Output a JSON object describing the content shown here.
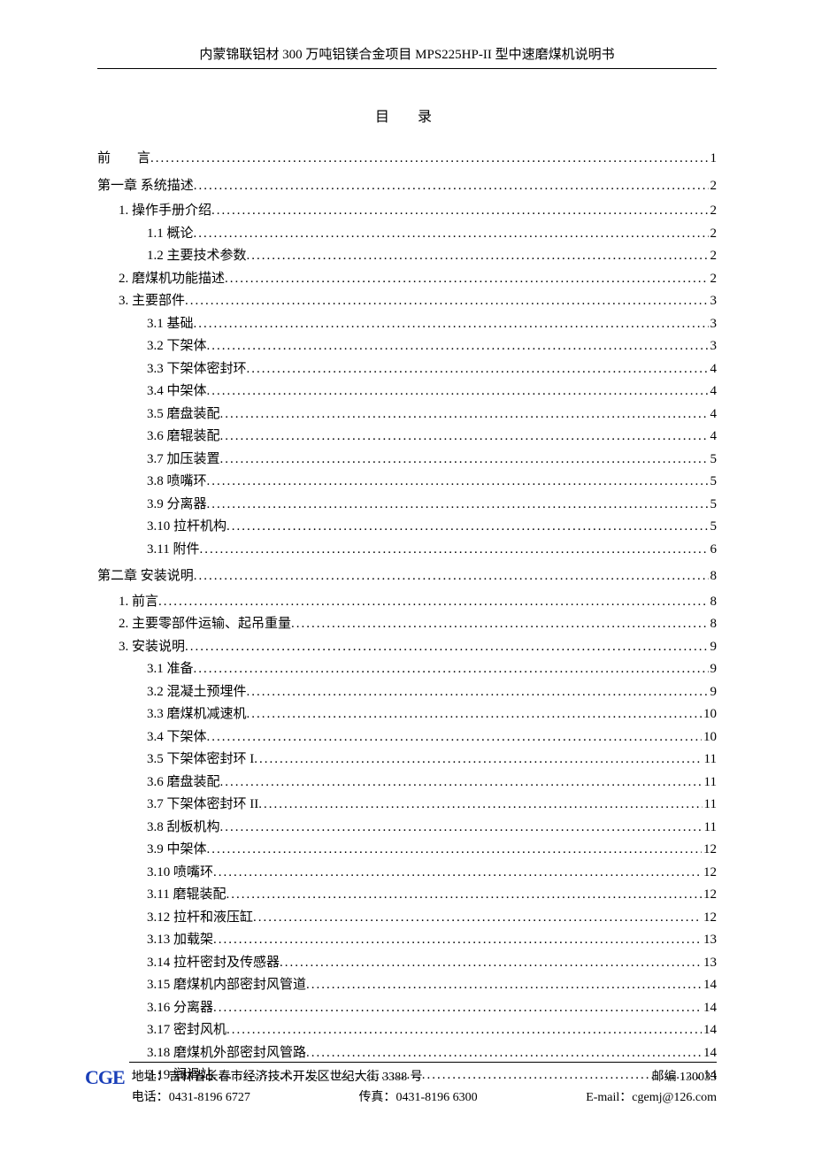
{
  "header": "内蒙锦联铝材 300 万吨铝镁合金项目 MPS225HP-II 型中速磨煤机说明书",
  "title": "目　录",
  "toc": [
    {
      "indent": 0,
      "label": "前　　言",
      "page": "1"
    },
    {
      "indent": 0,
      "label": "第一章  系统描述",
      "page": "2",
      "gap": true
    },
    {
      "indent": 1,
      "label": "1.  操作手册介绍",
      "page": "2"
    },
    {
      "indent": 2,
      "label": "1.1 概论",
      "page": "2"
    },
    {
      "indent": 2,
      "label": "1.2 主要技术参数",
      "page": "2"
    },
    {
      "indent": 1,
      "label": "2.  磨煤机功能描述",
      "page": "2"
    },
    {
      "indent": 1,
      "label": "3.  主要部件",
      "page": "3"
    },
    {
      "indent": 2,
      "label": "3.1 基础",
      "page": "3"
    },
    {
      "indent": 2,
      "label": "3.2 下架体",
      "page": "3"
    },
    {
      "indent": 2,
      "label": "3.3 下架体密封环",
      "page": "4"
    },
    {
      "indent": 2,
      "label": "3.4 中架体",
      "page": "4"
    },
    {
      "indent": 2,
      "label": "3.5 磨盘装配",
      "page": "4"
    },
    {
      "indent": 2,
      "label": "3.6 磨辊装配",
      "page": "4"
    },
    {
      "indent": 2,
      "label": "3.7 加压装置",
      "page": "5"
    },
    {
      "indent": 2,
      "label": "3.8 喷嘴环",
      "page": "5"
    },
    {
      "indent": 2,
      "label": "3.9 分离器",
      "page": "5"
    },
    {
      "indent": 2,
      "label": "3.10 拉杆机构",
      "page": "5"
    },
    {
      "indent": 2,
      "label": "3.11  附件",
      "page": "6"
    },
    {
      "indent": 0,
      "label": "第二章  安装说明",
      "page": "8",
      "gap": true
    },
    {
      "indent": 1,
      "label": "1.  前言",
      "page": "8"
    },
    {
      "indent": 1,
      "label": "2.  主要零部件运输、起吊重量",
      "page": "8"
    },
    {
      "indent": 1,
      "label": "3.  安装说明",
      "page": "9"
    },
    {
      "indent": 2,
      "label": "3.1  准备",
      "page": "9"
    },
    {
      "indent": 2,
      "label": "3.2  混凝土预埋件",
      "page": "9"
    },
    {
      "indent": 2,
      "label": "3.3  磨煤机减速机",
      "page": "10"
    },
    {
      "indent": 2,
      "label": "3.4  下架体",
      "page": "10"
    },
    {
      "indent": 2,
      "label": "3.5  下架体密封环 I",
      "page": "11"
    },
    {
      "indent": 2,
      "label": "3.6  磨盘装配",
      "page": "11"
    },
    {
      "indent": 2,
      "label": "3.7  下架体密封环 II",
      "page": "11"
    },
    {
      "indent": 2,
      "label": "3.8  刮板机构",
      "page": "11"
    },
    {
      "indent": 2,
      "label": "3.9  中架体",
      "page": "12"
    },
    {
      "indent": 2,
      "label": "3.10  喷嘴环",
      "page": "12"
    },
    {
      "indent": 2,
      "label": "3.11  磨辊装配",
      "page": "12"
    },
    {
      "indent": 2,
      "label": "3.12  拉杆和液压缸",
      "page": "12"
    },
    {
      "indent": 2,
      "label": "3.13  加载架",
      "page": "13"
    },
    {
      "indent": 2,
      "label": "3.14  拉杆密封及传感器",
      "page": "13"
    },
    {
      "indent": 2,
      "label": "3.15  磨煤机内部密封风管道",
      "page": "14"
    },
    {
      "indent": 2,
      "label": "3.16 分离器",
      "page": "14"
    },
    {
      "indent": 2,
      "label": "3.17  密封风机",
      "page": "14"
    },
    {
      "indent": 2,
      "label": "3.18  磨煤机外部密封风管路",
      "page": "14"
    },
    {
      "indent": 2,
      "label": "3.19  润滑站",
      "page": "14"
    }
  ],
  "footer": {
    "logo": "CGE",
    "address_label": "地址：",
    "address": "吉林省长春市经济技术开发区世纪大街 3388 号",
    "zip_label": "邮编",
    "zip": "130033",
    "phone_label": "电话：",
    "phone": "0431-8196 6727",
    "fax_label": "传真：",
    "fax": "0431-8196 6300",
    "email_label": "E-mail：",
    "email": "cgemj@126.com"
  }
}
